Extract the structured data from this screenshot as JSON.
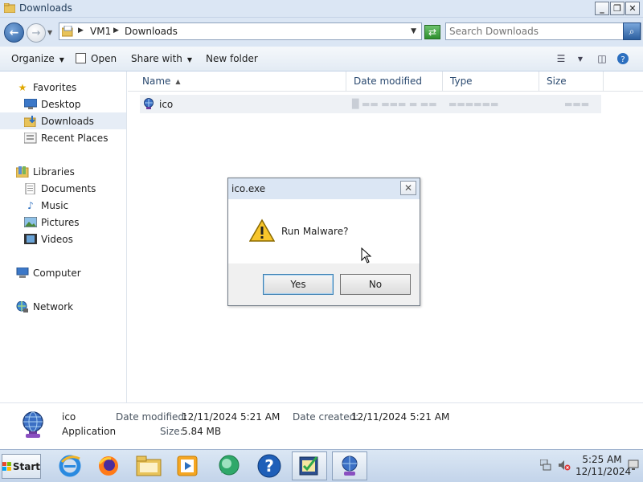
{
  "window": {
    "title": "Downloads",
    "controls": {
      "minimize": "_",
      "maximize": "❐",
      "close": "✕"
    }
  },
  "address": {
    "crumbs": [
      "VM1",
      "Downloads"
    ],
    "search_placeholder": "Search Downloads"
  },
  "toolbar": {
    "organize": "Organize",
    "open": "Open",
    "share_with": "Share with",
    "new_folder": "New folder"
  },
  "sidebar": {
    "favorites": {
      "label": "Favorites",
      "items": [
        "Desktop",
        "Downloads",
        "Recent Places"
      ]
    },
    "libraries": {
      "label": "Libraries",
      "items": [
        "Documents",
        "Music",
        "Pictures",
        "Videos"
      ]
    },
    "computer": "Computer",
    "network": "Network",
    "selected": "Downloads"
  },
  "filelist": {
    "columns": [
      "Name",
      "Date modified",
      "Type",
      "Size"
    ],
    "rows": [
      {
        "name": "ico"
      }
    ]
  },
  "details": {
    "name": "ico",
    "type": "Application",
    "date_modified_label": "Date modified:",
    "date_modified": "12/11/2024 5:21 AM",
    "date_created_label": "Date created:",
    "date_created": "12/11/2024 5:21 AM",
    "size_label": "Size:",
    "size": "5.84 MB"
  },
  "dialog": {
    "title": "ico.exe",
    "message": "Run Malware?",
    "yes": "Yes",
    "no": "No"
  },
  "taskbar": {
    "start": "Start",
    "time": "5:25 AM",
    "date": "12/11/2024",
    "pinned_icons": [
      "internet-explorer-icon",
      "firefox-icon",
      "file-explorer-icon",
      "media-player-icon",
      "chat-icon",
      "help-icon",
      "checklist-icon",
      "globe-app-icon"
    ]
  }
}
